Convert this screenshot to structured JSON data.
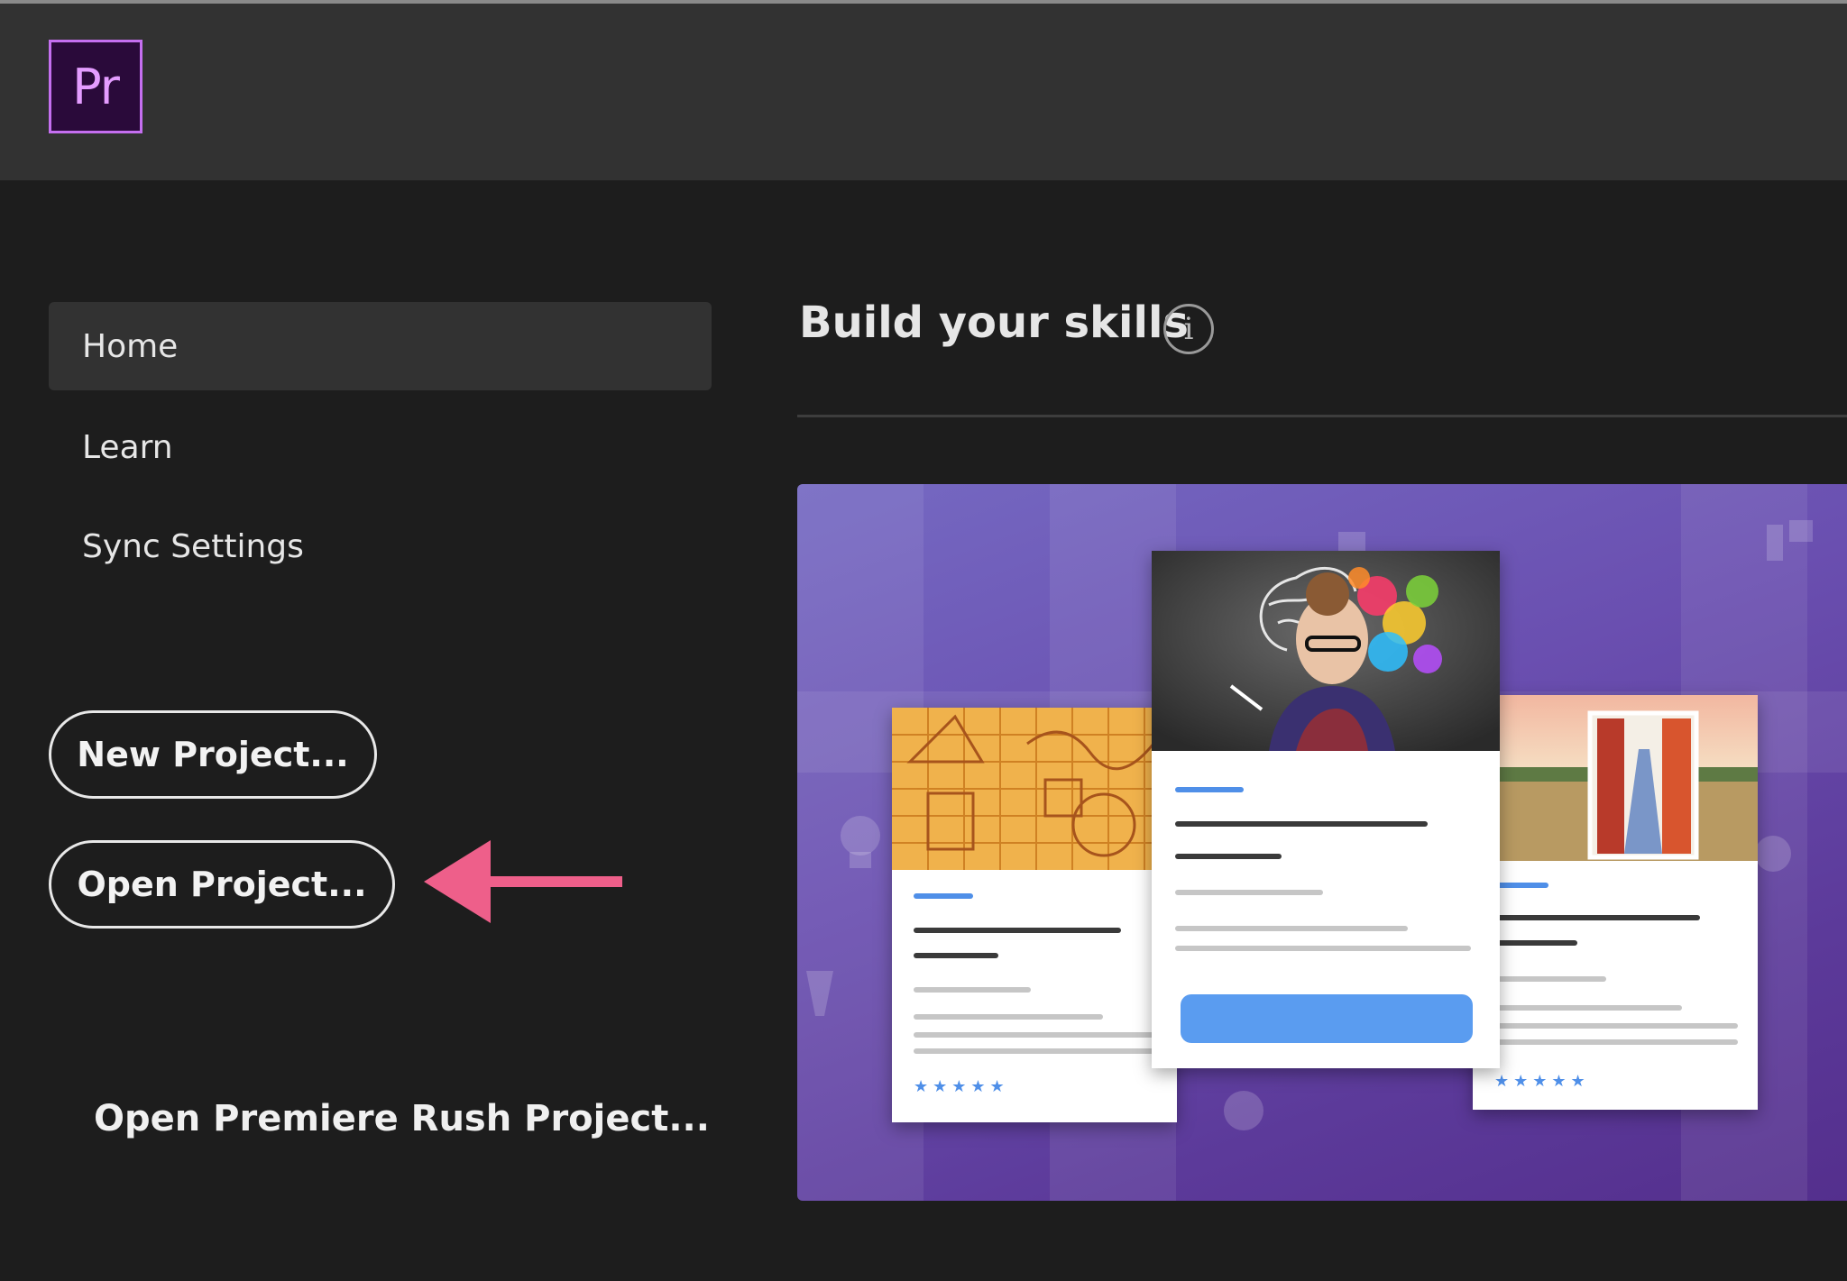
{
  "app": {
    "logo_text": "Pr",
    "accent": "#c56ff0"
  },
  "sidebar": {
    "items": [
      {
        "label": "Home",
        "active": true
      },
      {
        "label": "Learn",
        "active": false
      },
      {
        "label": "Sync Settings",
        "active": false
      }
    ],
    "new_project_label": "New Project...",
    "open_project_label": "Open Project...",
    "rush_project_label": "Open Premiere Rush Project..."
  },
  "main": {
    "section_title": "Build your skills",
    "info_icon": "i",
    "hero_colors": {
      "background": "#6a4fb0",
      "card_accent": "#4f8fe8"
    },
    "cards": [
      {
        "name": "math-sketch",
        "stars": "★★★★★"
      },
      {
        "name": "brain-portrait"
      },
      {
        "name": "field-street",
        "stars": "★★★★★"
      }
    ]
  },
  "annotation": {
    "arrow_color": "#ee5f8a"
  }
}
